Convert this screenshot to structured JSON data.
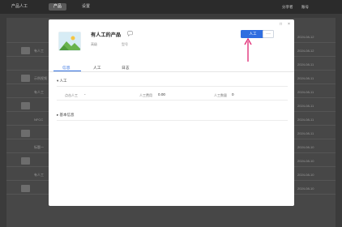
{
  "app": {
    "tabs": [
      "产品人工",
      "产品",
      "设置"
    ],
    "right_labels": [
      "分享者",
      "账号"
    ],
    "bg_rows": [
      {
        "text": "",
        "date": "2024-08-12"
      },
      {
        "text": "有人工",
        "date": "2024-08-12"
      },
      {
        "text": "",
        "date": "2024-08-11"
      },
      {
        "text": "示例视频",
        "date": "2024-08-11"
      },
      {
        "text": "有人工",
        "date": "2024-08-11"
      },
      {
        "text": "",
        "date": "2024-08-11"
      },
      {
        "text": "NFCC",
        "date": "2024-08-11"
      },
      {
        "text": "",
        "date": "2024-08-11"
      },
      {
        "text": "标题一",
        "date": "2024-08-10"
      },
      {
        "text": "",
        "date": "2024-08-10"
      },
      {
        "text": "有人工",
        "date": "2024-08-10"
      },
      {
        "text": "",
        "date": "2024-08-10"
      }
    ]
  },
  "modal": {
    "title": "有人工的产品",
    "meta": [
      "高级",
      "型号"
    ],
    "primary_button": "人工",
    "more_button": "···",
    "window_controls": [
      "□",
      "×"
    ],
    "tabs": [
      "信息",
      "人工",
      "日志"
    ],
    "sections": {
      "section1": "人工",
      "section2": "基本信息"
    },
    "fields": [
      {
        "label": "点击人工",
        "value": "-"
      },
      {
        "label": "人工费用",
        "value": "0.00"
      },
      {
        "label": "人工数量",
        "value": "0"
      }
    ]
  },
  "colors": {
    "primary": "#2f6ee0",
    "annotation_arrow": "#e2337a",
    "overlay_bg": "#3b3b3b"
  }
}
